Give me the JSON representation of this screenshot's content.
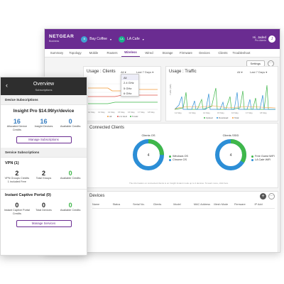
{
  "app": {
    "brand": "NETGEAR",
    "brand_sub": "Business",
    "locations": [
      {
        "icon": "location-icon",
        "name": "Bay Coffee",
        "badge": "B"
      },
      {
        "icon": "location-icon",
        "name": "LA Cafe",
        "badge": "LA"
      }
    ],
    "user": {
      "name": "Hi, Jaded",
      "role": "Pro Admin",
      "initial": "J"
    }
  },
  "tabs": [
    "Summary",
    "Topology",
    "Mobile",
    "Routers",
    "Wireless",
    "Wired",
    "Storage",
    "Firmware",
    "Devices",
    "Clients",
    "Troubleshoot"
  ],
  "active_tab": "Wireless",
  "toolbar": {
    "settings_label": "Settings",
    "more_label": "⋯"
  },
  "usage_clients": {
    "title": "Usage : Clients",
    "filter": "All",
    "range": "Last 7 Days",
    "x_ticks": [
      "12 May",
      "13 May",
      "14 May",
      "15 May",
      "16 May",
      "17 May",
      "18 May"
    ],
    "legend": [
      "All",
      "2.4 GHz",
      "5 GHz"
    ],
    "dropdown": [
      "All",
      "2.4 GHz",
      "5 GHz",
      "6 GHz"
    ]
  },
  "usage_traffic": {
    "title": "Usage : Traffic",
    "filter": "All",
    "range": "Last 7 Days",
    "ylabel": "Traffic (MB)",
    "x_ticks": [
      "12 May",
      "13 May",
      "14 May",
      "15 May",
      "16 May",
      "17 May",
      "18 May"
    ],
    "legend": [
      "Upload",
      "Download",
      "Total"
    ]
  },
  "connected": {
    "title": "Connected Clients",
    "donuts": [
      {
        "label": "Clients OS",
        "center": "4",
        "legend": [
          "Windows OS",
          "Chrome OS"
        ],
        "colors": [
          "#3fb74a",
          "#2c8ed6"
        ]
      },
      {
        "label": "Clients SSID",
        "center": "4",
        "legend": [
          "Free Guest WiFi",
          "LA Cafe WiFi"
        ],
        "colors": [
          "#3fb74a",
          "#2c8ed6"
        ]
      }
    ],
    "footnote": "The information on connected clients is on Insight Instant mode up to 4 devices. To learn more, click here"
  },
  "devices": {
    "title": "Devices",
    "columns": [
      "Name",
      "Status",
      "Serial No.",
      "Clients",
      "Model",
      "MAC Address",
      "Mesh Mode",
      "Firmware",
      "IP Add"
    ]
  },
  "phone": {
    "title": "Overview",
    "subtitle": "Subscriptions",
    "device_section": "Device Subscriptions",
    "plan": "Insight Pro $14.99/yr/device",
    "device_stats": [
      {
        "value": "16",
        "label": "Allocated Device Credits",
        "style": "blue"
      },
      {
        "value": "16",
        "label": "Insight Devices",
        "style": "blue"
      },
      {
        "value": "0",
        "label": "Available Credits",
        "style": "blue"
      }
    ],
    "manage_subs": "Manage Subscriptions",
    "service_section": "Service Subscriptions",
    "vpn_title": "VPN (1)",
    "vpn_stats": [
      {
        "value": "2",
        "label": "VPN Groups Credits 1 included Free",
        "style": "dark"
      },
      {
        "value": "2",
        "label": "Total Groups",
        "style": "dark"
      },
      {
        "value": "0",
        "label": "Available Credits",
        "style": "green"
      }
    ],
    "icp_title": "Instant Captive Portal (0)",
    "icp_stats": [
      {
        "value": "0",
        "label": "Instant Captive Portal Credits",
        "style": "dark"
      },
      {
        "value": "0",
        "label": "Total Devices",
        "style": "dark"
      },
      {
        "value": "0",
        "label": "Available Credits",
        "style": "green"
      }
    ],
    "manage_services": "Manage Services"
  },
  "colors": {
    "brand": "#6a2c91",
    "blue": "#2c8ed6",
    "green": "#3fb74a",
    "orange": "#f29a3a",
    "red": "#e0524a"
  }
}
